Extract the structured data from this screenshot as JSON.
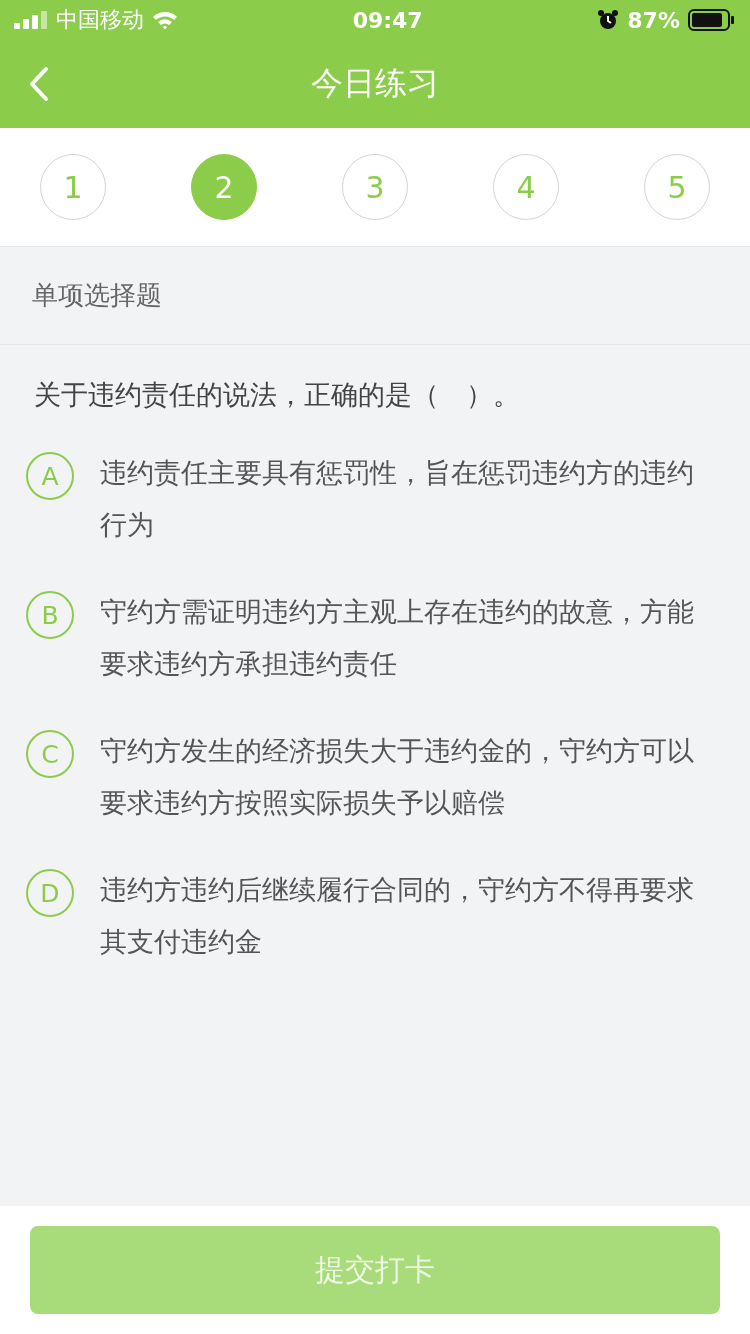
{
  "status_bar": {
    "carrier": "中国移动",
    "time": "09:47",
    "battery": "87%"
  },
  "nav": {
    "title": "今日练习"
  },
  "questions": [
    {
      "label": "1",
      "selected": false
    },
    {
      "label": "2",
      "selected": true
    },
    {
      "label": "3",
      "selected": false
    },
    {
      "label": "4",
      "selected": false
    },
    {
      "label": "5",
      "selected": false
    }
  ],
  "section": "单项选择题",
  "question": "关于违约责任的说法，正确的是（　）。",
  "options": [
    {
      "letter": "A",
      "text": "违约责任主要具有惩罚性，旨在惩罚违约方的违约行为",
      "selected": false
    },
    {
      "letter": "B",
      "text": "守约方需证明违约方主观上存在违约的故意，方能要求违约方承担违约责任",
      "selected": false
    },
    {
      "letter": "C",
      "text": "守约方发生的经济损失大于违约金的，守约方可以要求违约方按照实际损失予以赔偿",
      "selected": false
    },
    {
      "letter": "D",
      "text": "违约方违约后继续履行合同的，守约方不得再要求其支付违约金",
      "selected": false
    }
  ],
  "submit": {
    "label": "提交打卡",
    "disabled": true
  }
}
